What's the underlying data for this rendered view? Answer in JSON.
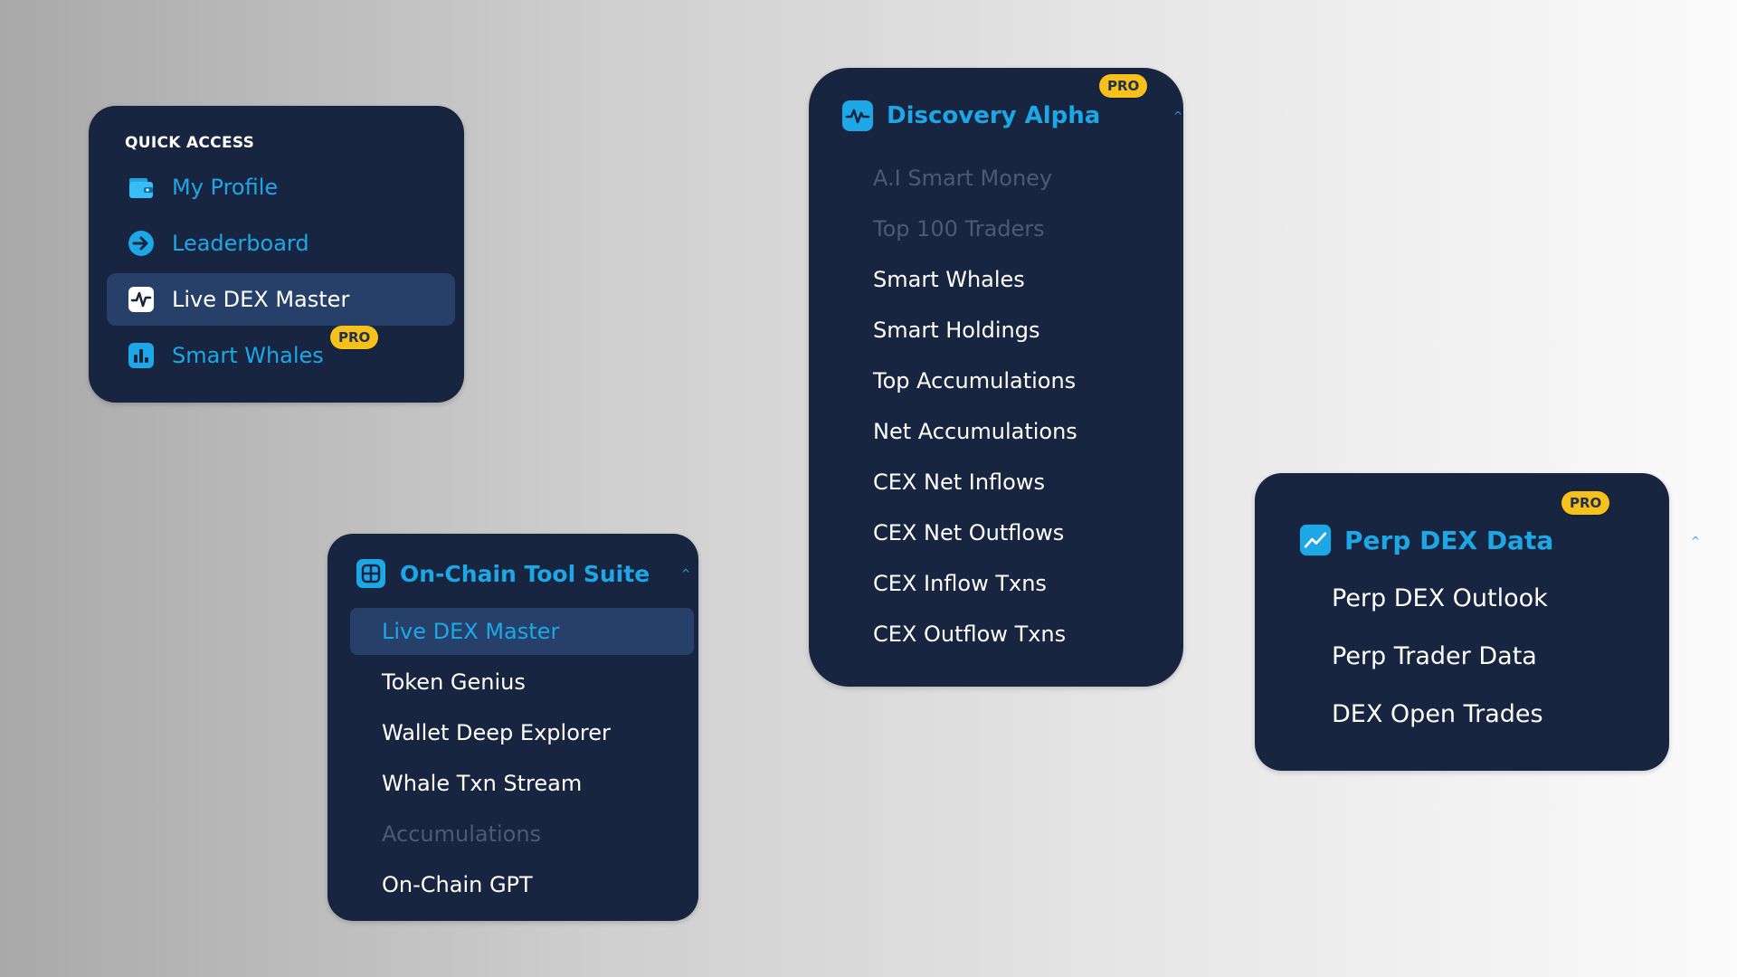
{
  "colors": {
    "panel_bg": "#172540",
    "active_bg": "#26406a",
    "accent_blue": "#1ea7e6",
    "disabled_text": "#4d5a70",
    "pro_badge": "#f6c11a"
  },
  "badge_label": "PRO",
  "quick_access": {
    "header": "QUICK ACCESS",
    "items": [
      {
        "label": "My Profile",
        "icon": "wallet-icon",
        "active": false,
        "pro": false
      },
      {
        "label": "Leaderboard",
        "icon": "arrow-right-circle-icon",
        "active": false,
        "pro": false
      },
      {
        "label": "Live DEX Master",
        "icon": "activity-icon",
        "active": true,
        "pro": false
      },
      {
        "label": "Smart Whales",
        "icon": "bar-chart-icon",
        "active": false,
        "pro": true
      }
    ]
  },
  "onchain_suite": {
    "title": "On-Chain Tool Suite",
    "icon": "grid-icon",
    "expanded": true,
    "items": [
      {
        "label": "Live DEX Master",
        "state": "active"
      },
      {
        "label": "Token Genius",
        "state": "normal"
      },
      {
        "label": "Wallet Deep Explorer",
        "state": "normal"
      },
      {
        "label": "Whale Txn Stream",
        "state": "normal"
      },
      {
        "label": "Accumulations",
        "state": "disabled"
      },
      {
        "label": "On-Chain GPT",
        "state": "normal"
      }
    ]
  },
  "discovery_alpha": {
    "title": "Discovery Alpha",
    "icon": "pulse-icon",
    "pro": true,
    "expanded": true,
    "items": [
      {
        "label": "A.I Smart Money",
        "state": "disabled"
      },
      {
        "label": "Top 100 Traders",
        "state": "disabled"
      },
      {
        "label": "Smart Whales",
        "state": "normal"
      },
      {
        "label": "Smart Holdings",
        "state": "normal"
      },
      {
        "label": "Top Accumulations",
        "state": "normal"
      },
      {
        "label": "Net Accumulations",
        "state": "normal"
      },
      {
        "label": "CEX Net Inflows",
        "state": "normal"
      },
      {
        "label": "CEX Net Outflows",
        "state": "normal"
      },
      {
        "label": "CEX Inflow Txns",
        "state": "normal"
      },
      {
        "label": "CEX Outflow Txns",
        "state": "normal"
      }
    ]
  },
  "perp_dex": {
    "title": "Perp DEX Data",
    "icon": "trend-line-icon",
    "pro": true,
    "expanded": true,
    "items": [
      {
        "label": "Perp DEX Outlook",
        "state": "normal"
      },
      {
        "label": "Perp Trader Data",
        "state": "normal"
      },
      {
        "label": "DEX Open Trades",
        "state": "normal"
      }
    ]
  }
}
